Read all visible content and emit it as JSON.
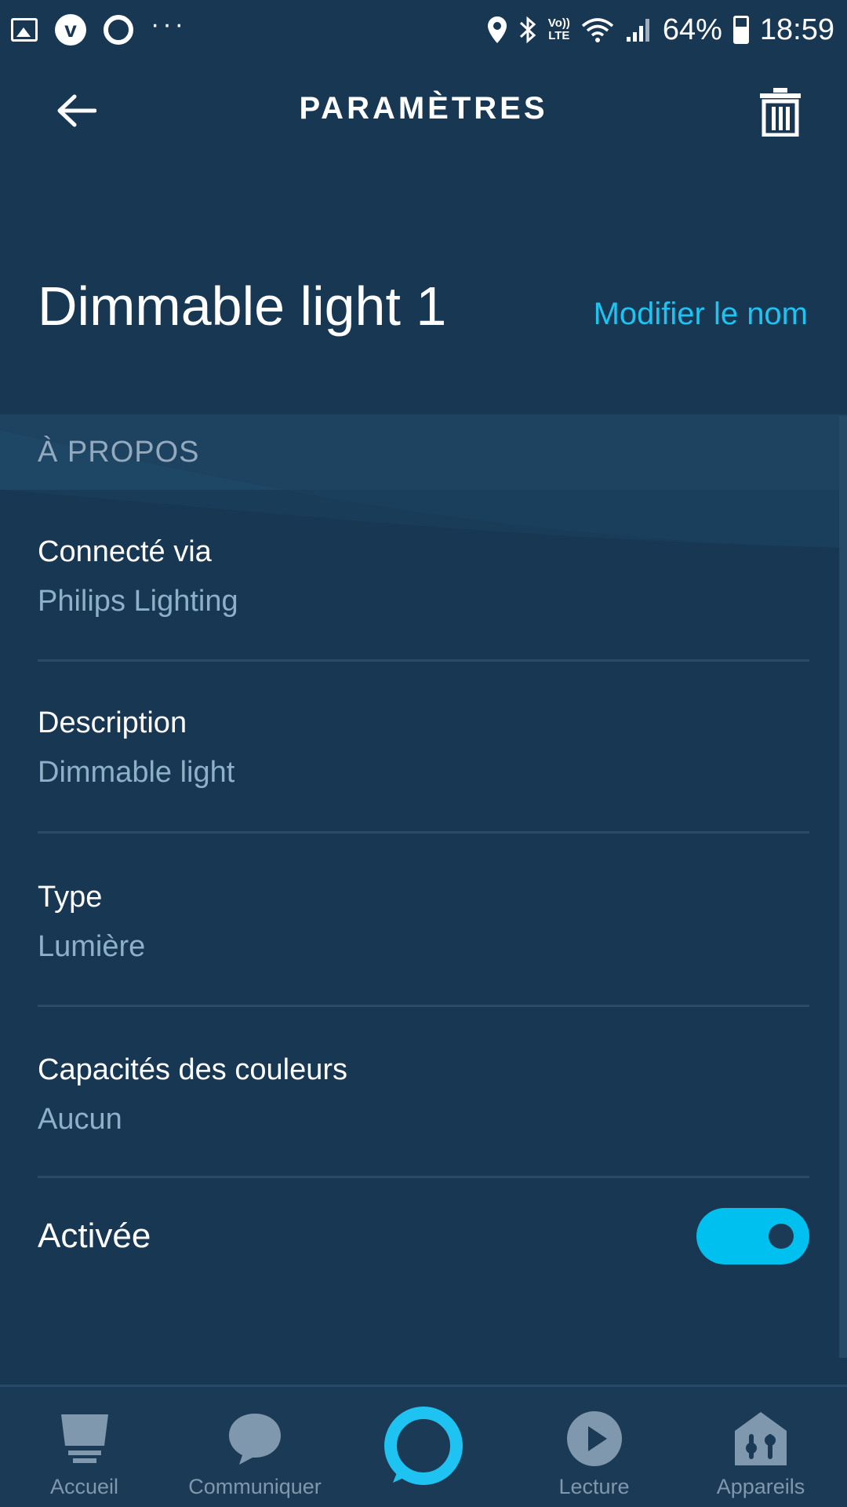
{
  "status_bar": {
    "battery": "64%",
    "time": "18:59",
    "volte_top": "Vo))",
    "volte_bottom": "LTE",
    "left_icons": [
      "gallery-icon",
      "vpn-v-icon",
      "circle-app-icon",
      "more-dots-icon"
    ],
    "right_icons": [
      "location-icon",
      "bluetooth-icon",
      "volte-icon",
      "wifi-icon",
      "signal-icon",
      "battery-icon"
    ]
  },
  "header": {
    "title": "PARAMÈTRES",
    "back_icon": "back-arrow-icon",
    "delete_icon": "trash-icon"
  },
  "device": {
    "name": "Dimmable light 1",
    "rename_label": "Modifier le nom"
  },
  "section": {
    "title": "À PROPOS"
  },
  "rows": [
    {
      "label": "Connecté via",
      "value": "Philips Lighting"
    },
    {
      "label": "Description",
      "value": "Dimmable light"
    },
    {
      "label": "Type",
      "value": "Lumière"
    },
    {
      "label": "Capacités des couleurs",
      "value": "Aucun"
    }
  ],
  "enabled": {
    "label": "Activée",
    "state": true
  },
  "bottom_nav": {
    "items": [
      {
        "label": "Accueil",
        "icon": "home-icon"
      },
      {
        "label": "Communiquer",
        "icon": "chat-bubble-icon"
      },
      {
        "label": "",
        "icon": "alexa-ring-icon"
      },
      {
        "label": "Lecture",
        "icon": "play-icon"
      },
      {
        "label": "Appareils",
        "icon": "devices-icon"
      }
    ]
  },
  "colors": {
    "background": "#173753",
    "accent": "#1fc3f2",
    "toggle_on": "#00c0f0",
    "secondary_text": "#8eb1c8",
    "nav_inactive": "#7f98ad"
  }
}
